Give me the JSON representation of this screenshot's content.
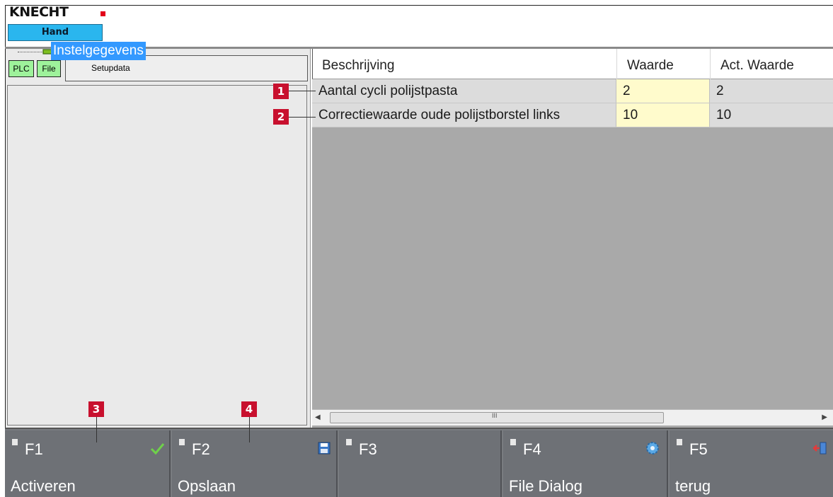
{
  "header": {
    "logo_text": "KNECHT",
    "mode_label": "Hand"
  },
  "left_panel": {
    "plc_button": "PLC",
    "file_button": "File",
    "path_text": "Setupdata",
    "tree_item": "Instelgegevens"
  },
  "grid": {
    "columns": [
      "Beschrijving",
      "Waarde",
      "Act. Waarde"
    ],
    "rows": [
      {
        "description": "Aantal cycli polijstpasta",
        "value": "2",
        "actual": "2"
      },
      {
        "description": "Correctiewaarde oude polijstborstel links",
        "value": "10",
        "actual": "10"
      }
    ],
    "scroll_grip": "III"
  },
  "callouts": [
    "1",
    "2",
    "3",
    "4"
  ],
  "function_keys": [
    {
      "key": "F1",
      "label": "Activeren",
      "icon": "check-icon"
    },
    {
      "key": "F2",
      "label": "Opslaan",
      "icon": "save-icon"
    },
    {
      "key": "F3",
      "label": "",
      "icon": ""
    },
    {
      "key": "F4",
      "label": "File Dialog",
      "icon": "gear-icon"
    },
    {
      "key": "F5",
      "label": "terug",
      "icon": "exit-icon"
    }
  ],
  "colors": {
    "mode_badge": "#2ab6ee",
    "green_button": "#9ef29b",
    "selection": "#3399ff",
    "value_cell": "#fffbcc",
    "callout": "#c8102e",
    "fkey_bar": "#6e7176"
  }
}
